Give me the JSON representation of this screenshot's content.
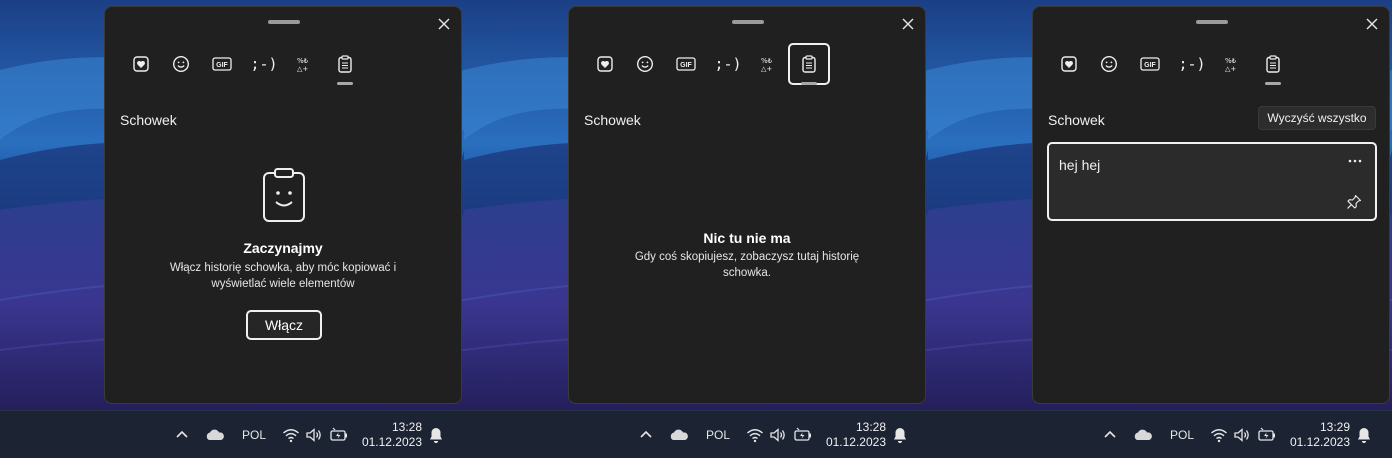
{
  "colors": {
    "panel_bg": "#202020",
    "panel_border": "#3a3a3a",
    "text": "#f0f0f0",
    "taskbar_bg": "#1c2333",
    "item_bg": "#2b2b2b"
  },
  "panel": {
    "tabs": [
      {
        "icon": "kaomoji-heart-icon"
      },
      {
        "icon": "emoji-icon"
      },
      {
        "icon": "gif-icon",
        "label": "GIF"
      },
      {
        "icon": "kaomoji-icon",
        "label": ";-)"
      },
      {
        "icon": "symbols-icon",
        "label": "%₺△+"
      },
      {
        "icon": "clipboard-icon"
      }
    ],
    "section_title": "Schowek"
  },
  "screens": [
    {
      "state": "disabled",
      "heading": "Zaczynajmy",
      "body": "Włącz historię schowka, aby móc kopiować i wyświetlać wiele elementów",
      "enable_button": "Włącz"
    },
    {
      "state": "empty",
      "heading": "Nic tu nie ma",
      "body": "Gdy coś skopiujesz, zobaczysz tutaj historię schowka."
    },
    {
      "state": "populated",
      "clear_all_button": "Wyczyść wszystko",
      "items": [
        {
          "text": "hej hej"
        }
      ]
    }
  ],
  "taskbars": [
    {
      "language": "POL",
      "time": "13:28",
      "date": "01.12.2023"
    },
    {
      "language": "POL",
      "time": "13:28",
      "date": "01.12.2023"
    },
    {
      "language": "POL",
      "time": "13:29",
      "date": "01.12.2023"
    }
  ]
}
